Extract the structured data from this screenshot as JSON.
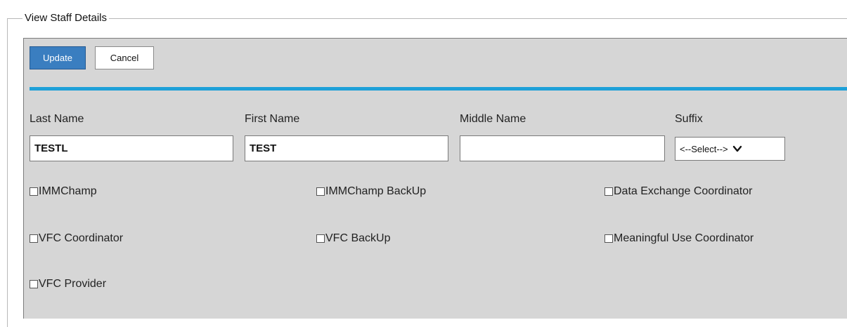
{
  "legend": "View Staff Details",
  "buttons": {
    "update": "Update",
    "cancel": "Cancel"
  },
  "labels": {
    "last_name": "Last Name",
    "first_name": "First Name",
    "middle_name": "Middle Name",
    "suffix": "Suffix"
  },
  "values": {
    "last_name": "TESTL",
    "first_name": "TEST",
    "middle_name": "",
    "suffix": "<--Select-->"
  },
  "checkboxes": {
    "immchamp": "IMMChamp",
    "immchamp_backup": "IMMChamp BackUp",
    "data_exchange": "Data Exchange Coordinator",
    "vfc_coordinator": "VFC Coordinator",
    "vfc_backup": "VFC BackUp",
    "meaningful_use": "Meaningful Use Coordinator",
    "vfc_provider": "VFC Provider"
  },
  "colors": {
    "accent": "#1ea0d8",
    "primary_button": "#3a7ec0",
    "panel": "#d6d6d6"
  }
}
